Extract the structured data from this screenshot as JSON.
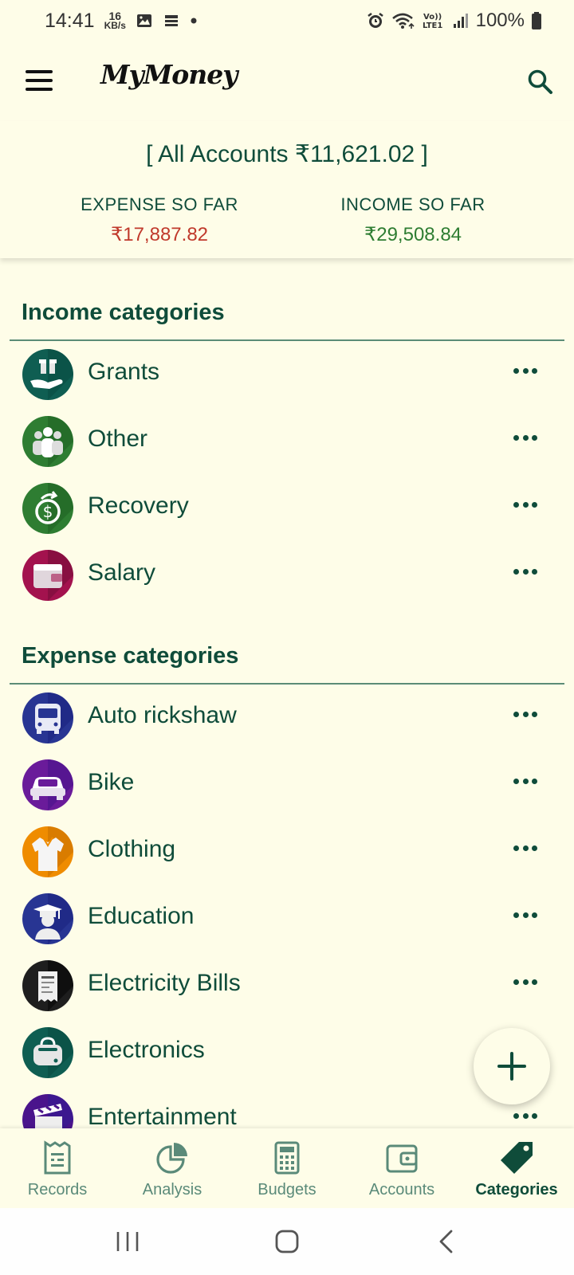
{
  "status_bar": {
    "time": "14:41",
    "net_speed_value": "16",
    "net_speed_unit": "KB/s",
    "battery": "100%"
  },
  "app_bar": {
    "brand": "MyMoney"
  },
  "summary": {
    "all_accounts": "[ All Accounts ₹11,621.02 ]",
    "expense_label": "EXPENSE SO FAR",
    "expense_value": "₹17,887.82",
    "income_label": "INCOME SO FAR",
    "income_value": "₹29,508.84",
    "colors": {
      "expense": "#c0392b",
      "income": "#2e7d32"
    }
  },
  "income_section": {
    "title": "Income categories",
    "items": [
      {
        "name": "Grants",
        "icon": "gift-hand-icon",
        "color": "#0f5e52"
      },
      {
        "name": "Other",
        "icon": "people-icon",
        "color": "#2e7d32"
      },
      {
        "name": "Recovery",
        "icon": "money-recovery-icon",
        "color": "#2e7d32"
      },
      {
        "name": "Salary",
        "icon": "wallet-icon",
        "color": "#a3124e"
      }
    ]
  },
  "expense_section": {
    "title": "Expense categories",
    "items": [
      {
        "name": "Auto rickshaw",
        "icon": "bus-icon",
        "color": "#283593"
      },
      {
        "name": "Bike",
        "icon": "car-icon",
        "color": "#6a1b9a"
      },
      {
        "name": "Clothing",
        "icon": "shirt-icon",
        "color": "#ef8c00"
      },
      {
        "name": "Education",
        "icon": "graduate-icon",
        "color": "#283593"
      },
      {
        "name": "Electricity Bills",
        "icon": "bill-icon",
        "color": "#1e1e1e"
      },
      {
        "name": "Electronics",
        "icon": "toaster-icon",
        "color": "#0f5e52"
      },
      {
        "name": "Entertainment",
        "icon": "clapper-icon",
        "color": "#4a148c"
      }
    ]
  },
  "bottom_nav": {
    "items": [
      {
        "label": "Records",
        "icon": "records-icon",
        "active": false
      },
      {
        "label": "Analysis",
        "icon": "pie-chart-icon",
        "active": false
      },
      {
        "label": "Budgets",
        "icon": "calculator-icon",
        "active": false
      },
      {
        "label": "Accounts",
        "icon": "wallet-icon",
        "active": false
      },
      {
        "label": "Categories",
        "icon": "tag-icon",
        "active": true
      }
    ]
  },
  "fab": {
    "icon": "plus-icon"
  }
}
